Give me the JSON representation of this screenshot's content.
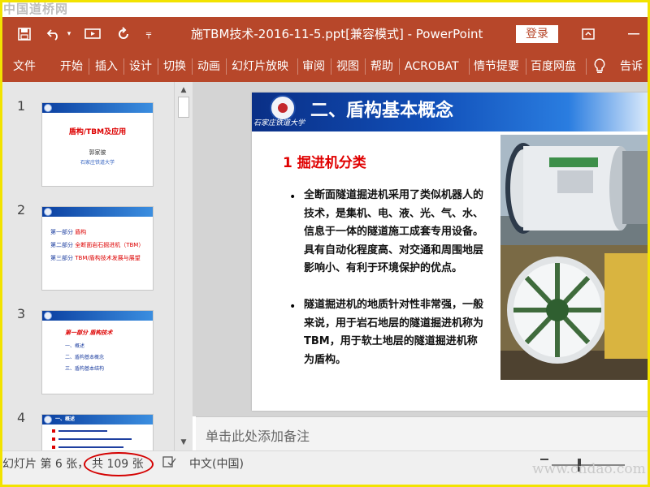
{
  "watermark": {
    "top": "中国道桥网",
    "bottom": "www.cndao.com"
  },
  "titlebar": {
    "document_title": "施TBM技术-2016-11-5.ppt[兼容模式]  -  PowerPoint",
    "login_label": "登录",
    "icons": [
      "save-icon",
      "undo-icon",
      "dropdown-icon",
      "slideshow-icon",
      "repeat-icon",
      "customize-icon",
      "ribbon-display-icon",
      "minimize-icon"
    ]
  },
  "ribbon": {
    "tabs": [
      "文件",
      "开始",
      "插入",
      "设计",
      "切换",
      "动画",
      "幻灯片放映",
      "审阅",
      "视图",
      "帮助",
      "ACROBAT",
      "情节提要",
      "百度网盘"
    ],
    "tell_me": "告诉"
  },
  "thumbnails": [
    {
      "number": "1",
      "title": "盾构/TBM及应用",
      "author": "郭家彼",
      "org": "石家庄铁道大学"
    },
    {
      "number": "2",
      "lines": [
        {
          "label": "第一部分",
          "value": "盾构"
        },
        {
          "label": "第二部分",
          "value": "全断面岩石掘进机（TBM）"
        },
        {
          "label": "第三部分",
          "value": "TBM/盾构技术发展与展望"
        }
      ]
    },
    {
      "number": "3",
      "heading": "第一部分  盾构技术",
      "items": [
        "一、概述",
        "二、盾构基本概念",
        "三、盾构基本结构"
      ]
    },
    {
      "number": "4",
      "heading": "一、概述"
    }
  ],
  "slide": {
    "school": "石家庄铁道大学",
    "heading": "二、盾构基本概念",
    "subheading": "1  掘进机分类",
    "bullets": [
      "全断面隧道掘进机采用了类似机器人的技术，是集机、电、液、光、气、水、信息于一体的隧道施工成套专用设备。具有自动化程度高、对交通和周围地层影响小、有利于环境保护的优点。",
      "隧道掘进机的地质针对性非常强，一般来说，用于岩石地层的隧道掘进机称为TBM，用于软土地层的隧道掘进机称为盾构。"
    ],
    "photos": [
      "TBM machine photo",
      "shield cutterhead photo"
    ]
  },
  "notes": {
    "placeholder": "单击此处添加备注"
  },
  "statusbar": {
    "slide_info": "幻灯片 第 6 张，",
    "total": "共 109 张",
    "language": "中文(中国)",
    "highlight_color": "#d40000"
  },
  "colors": {
    "ribbon": "#b7472a",
    "frame": "#f2e300",
    "slide_heading": "#ffffff",
    "subheading": "#e00000"
  }
}
